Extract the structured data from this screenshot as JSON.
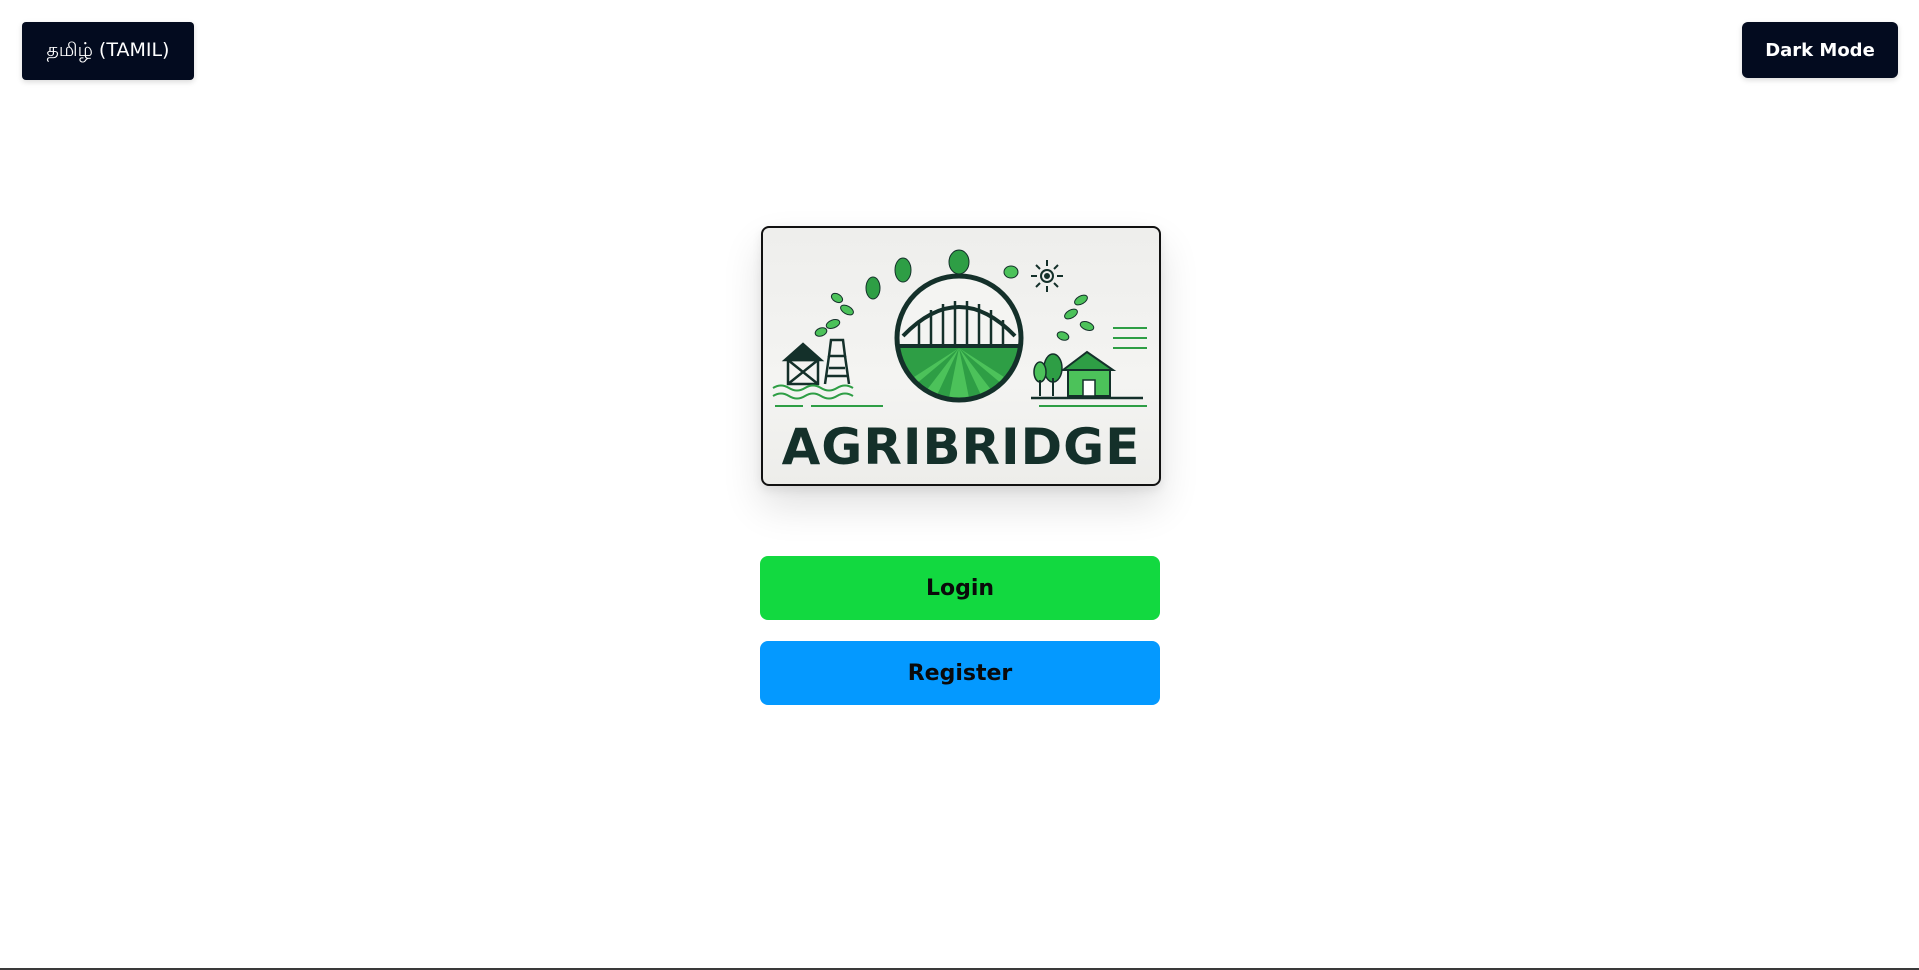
{
  "header": {
    "language_label": "தமிழ் (TAMIL)",
    "theme_label": "Dark Mode"
  },
  "logo": {
    "text": "AGRIBRIDGE",
    "colors": {
      "dark": "#14302a",
      "green": "#2e9e45",
      "light_green": "#4cc25a"
    }
  },
  "actions": {
    "login_label": "Login",
    "register_label": "Register"
  },
  "colors": {
    "login": "#12d940",
    "register": "#0499ff",
    "dark_button": "#030b1f"
  }
}
